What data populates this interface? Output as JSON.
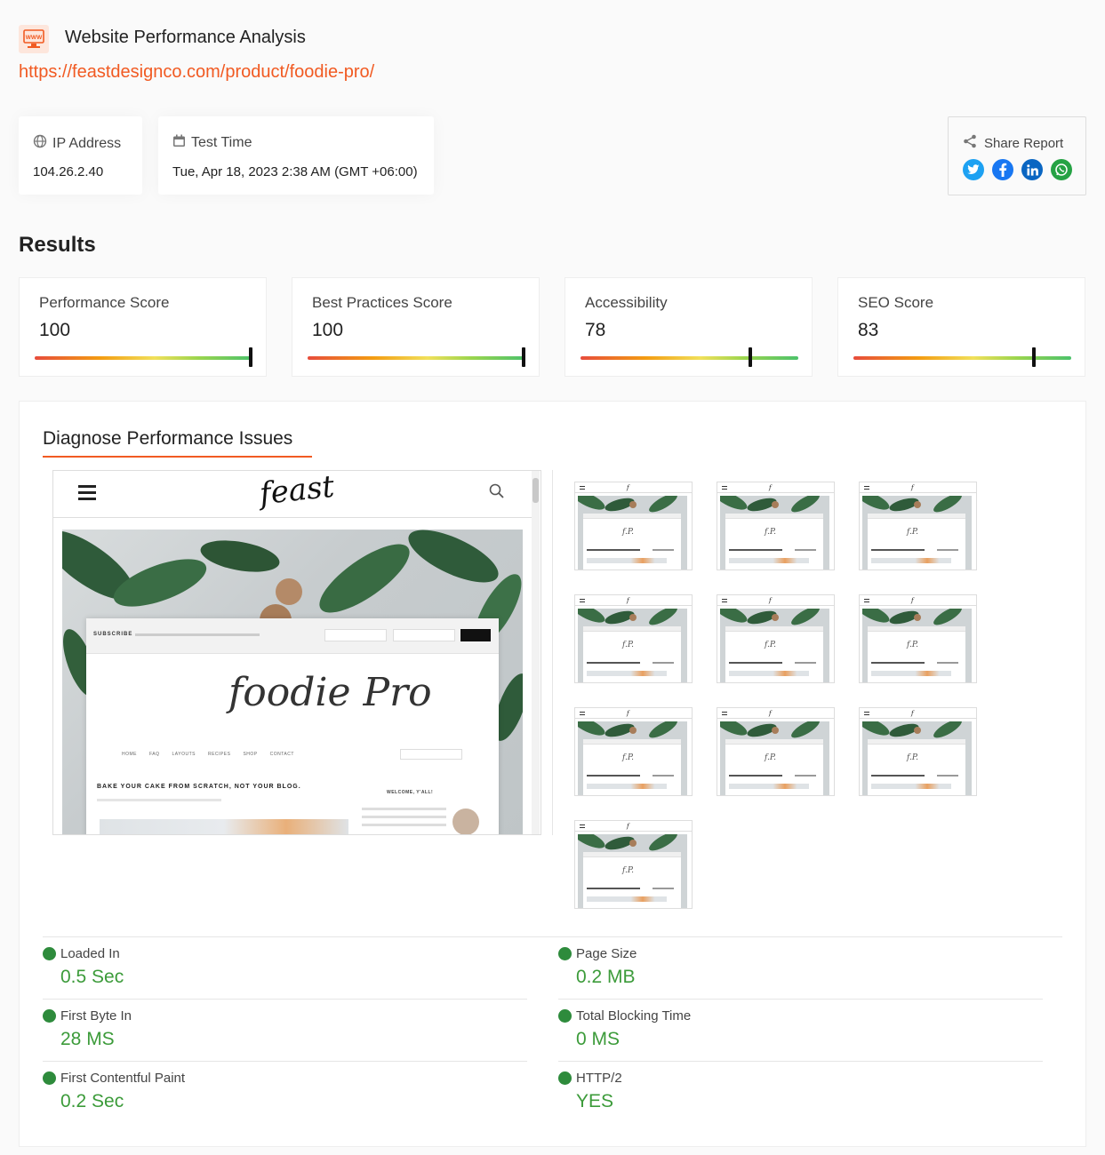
{
  "header": {
    "title": "Website Performance Analysis",
    "url": "https://feastdesignco.com/product/foodie-pro/",
    "logo_icon": "www-monitor-icon"
  },
  "info": {
    "ip_label": "IP Address",
    "ip_value": "104.26.2.40",
    "time_label": "Test Time",
    "time_value": "Tue, Apr 18, 2023 2:38 AM (GMT +06:00)"
  },
  "share": {
    "label": "Share Report",
    "networks": [
      "twitter",
      "facebook",
      "linkedin",
      "whatsapp"
    ],
    "colors": {
      "twitter": "#1da1f2",
      "facebook": "#1877f2",
      "linkedin": "#0a66c2",
      "whatsapp": "#25a244"
    }
  },
  "results": {
    "heading": "Results",
    "scores": [
      {
        "label": "Performance Score",
        "value": "100",
        "fraction": 1.0
      },
      {
        "label": "Best Practices Score",
        "value": "100",
        "fraction": 1.0
      },
      {
        "label": "Accessibility",
        "value": "78",
        "fraction": 0.78
      },
      {
        "label": "SEO Score",
        "value": "83",
        "fraction": 0.83
      }
    ]
  },
  "diagnose": {
    "title": "Diagnose Performance Issues",
    "preview": {
      "brand": "feast",
      "subscribe_label": "SUBSCRIBE",
      "script_logo": "foodie Pro",
      "nav": [
        "HOME",
        "FAQ",
        "LAYOUTS",
        "RECIPES",
        "SHOP",
        "CONTACT"
      ],
      "headline": "BAKE YOUR CAKE FROM SCRATCH, NOT YOUR BLOG.",
      "welcome": "WELCOME, Y'ALL!"
    },
    "thumbnail_count": 10
  },
  "metrics": [
    {
      "label": "Loaded In",
      "value": "0.5 Sec"
    },
    {
      "label": "Page Size",
      "value": "0.2 MB"
    },
    {
      "label": "First Byte In",
      "value": "28 MS"
    },
    {
      "label": "Total Blocking Time",
      "value": "0 MS"
    },
    {
      "label": "First Contentful Paint",
      "value": "0.2 Sec"
    },
    {
      "label": "HTTP/2",
      "value": "YES"
    }
  ],
  "colors": {
    "accent": "#f15a22",
    "good": "#3c9b3a",
    "dot": "#2e8b3c"
  }
}
